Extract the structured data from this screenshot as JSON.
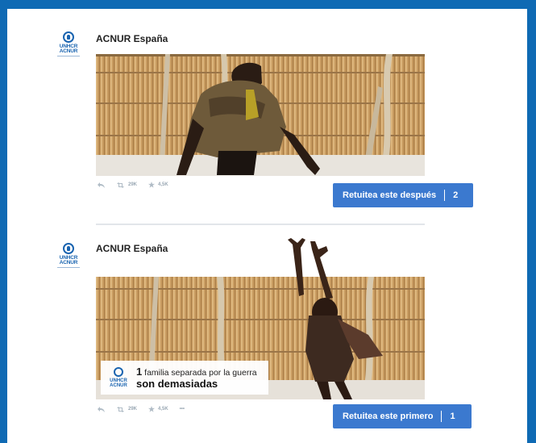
{
  "tweets": [
    {
      "account_name": "ACNUR España",
      "logo_text": [
        "UNHCR",
        "ACNUR"
      ],
      "actions": {
        "reply_icon": "reply-icon",
        "retweet_count": "29K",
        "favorite_count": "4,5K"
      },
      "cta": {
        "label": "Retuitea este después",
        "number": "2"
      }
    },
    {
      "account_name": "ACNUR España",
      "logo_text": [
        "UNHCR",
        "ACNUR"
      ],
      "image_caption": {
        "number": "1",
        "line1_rest": "familia separada por la guerra",
        "line2": "son demasiadas"
      },
      "actions": {
        "reply_icon": "reply-icon",
        "retweet_count": "29K",
        "favorite_count": "4,5K",
        "more_label": "•••"
      },
      "cta": {
        "label": "Retuitea este primero",
        "number": "1"
      }
    }
  ],
  "colors": {
    "frame_border": "#0f6ab4",
    "cta_bg": "#3b79cf",
    "brand_blue": "#1a64b0"
  }
}
